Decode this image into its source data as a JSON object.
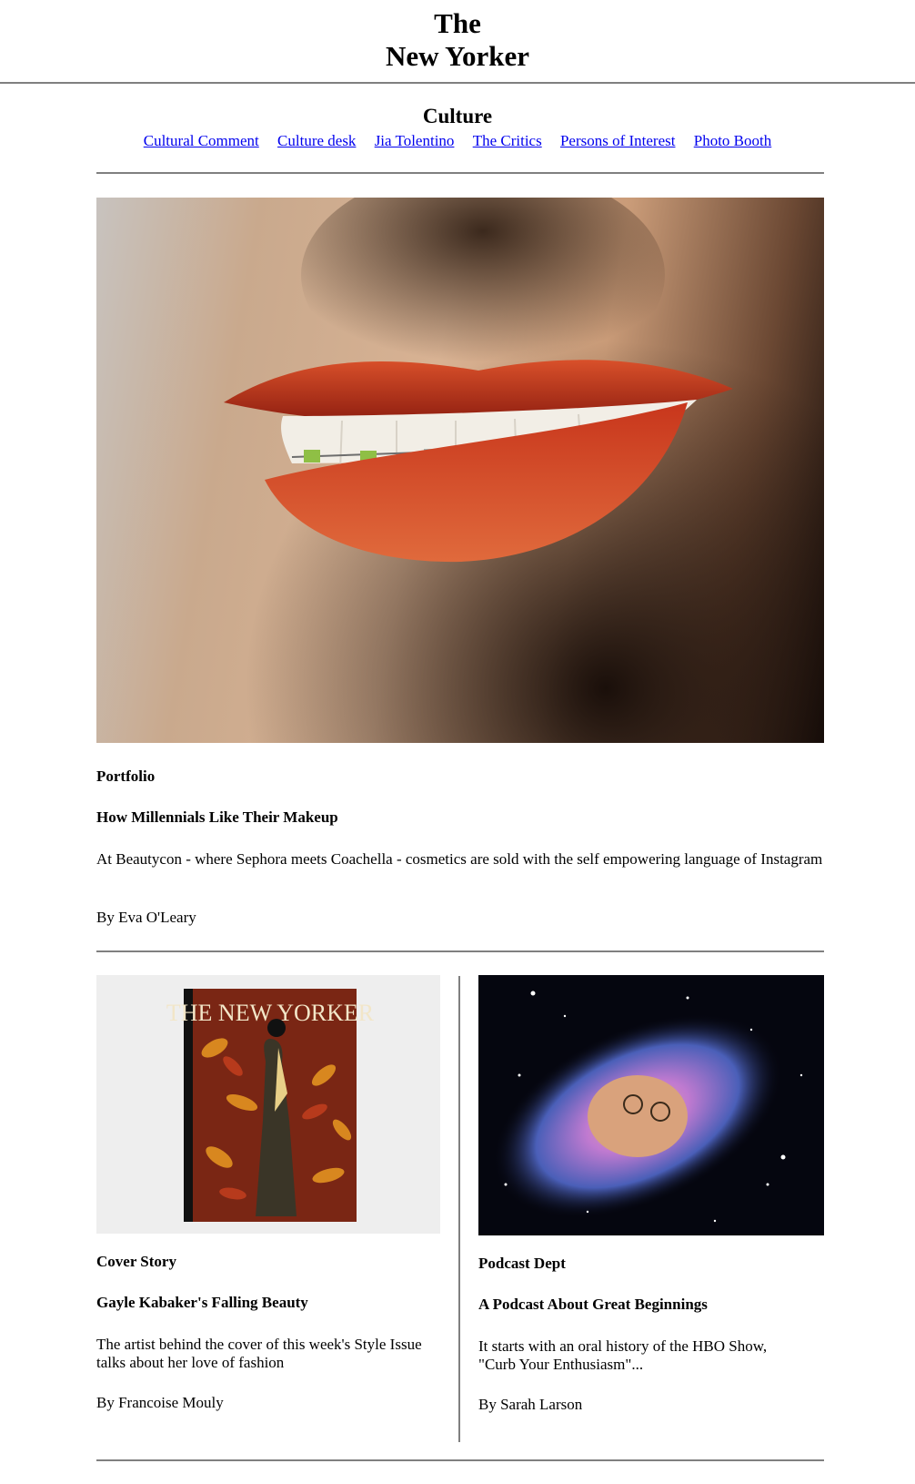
{
  "masthead": {
    "line1": "The",
    "line2": "New Yorker"
  },
  "section": {
    "title": "Culture",
    "nav": [
      "Cultural Comment",
      "Culture desk",
      "Jia Tolentino",
      "The Critics",
      "Persons of Interest",
      "Photo Booth"
    ]
  },
  "hero": {
    "kicker": "Portfolio",
    "headline": "How Millennials Like Their Makeup",
    "dek": "At Beautycon - where Sephora meets Coachella - cosmetics are sold with the self empowering language of Instagram",
    "byline": "By Eva O'Leary"
  },
  "cards": [
    {
      "kicker": "Cover Story",
      "headline": "Gayle Kabaker's Falling Beauty",
      "dek": "The artist behind the cover of this week's Style Issue talks about her love of fashion",
      "byline": "By Francoise Mouly",
      "image_text": "THE NEW YORKER"
    },
    {
      "kicker": "Podcast Dept",
      "headline": "A Podcast About Great Beginnings",
      "dek": "It starts with an oral history of the HBO Show, \"Curb Your Enthusiasm\"...",
      "byline": "By Sarah Larson"
    }
  ],
  "colors": {
    "link": "#0000ee",
    "rule": "#808080",
    "text": "#000000"
  }
}
